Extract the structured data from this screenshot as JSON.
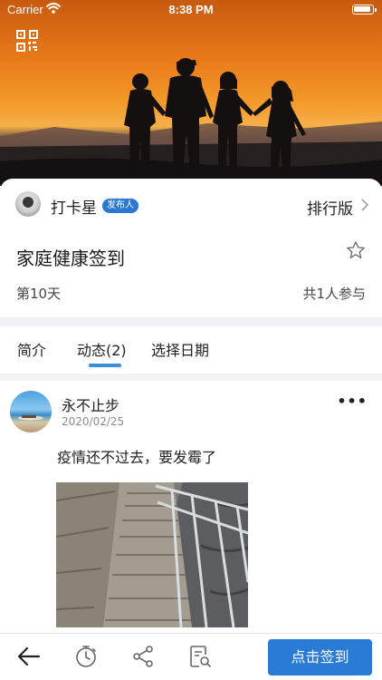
{
  "status_bar": {
    "carrier": "Carrier",
    "time": "8:38 PM"
  },
  "publisher": {
    "name": "打卡星",
    "badge": "发布人"
  },
  "ranking": {
    "label": "排行版"
  },
  "activity": {
    "title": "家庭健康签到",
    "day": "第10天",
    "participants": "共1人参与"
  },
  "tabs": [
    {
      "label": "简介",
      "active": false
    },
    {
      "label": "动态(2)",
      "active": true
    },
    {
      "label": "选择日期",
      "active": false
    }
  ],
  "post": {
    "author": "永不止步",
    "date": "2020/02/25",
    "text": "疫情还不过去，要发霉了"
  },
  "bottom_bar": {
    "checkin_label": "点击签到"
  },
  "icons": [
    "qr-code-icon",
    "chevron-right-icon",
    "star-outline-icon",
    "more-icon",
    "back-arrow-icon",
    "stopwatch-icon",
    "share-icon",
    "document-search-icon"
  ],
  "colors": {
    "accent": "#2a7bd6",
    "badge": "#2a78d4",
    "tab_underline": "#3b8fd9"
  }
}
